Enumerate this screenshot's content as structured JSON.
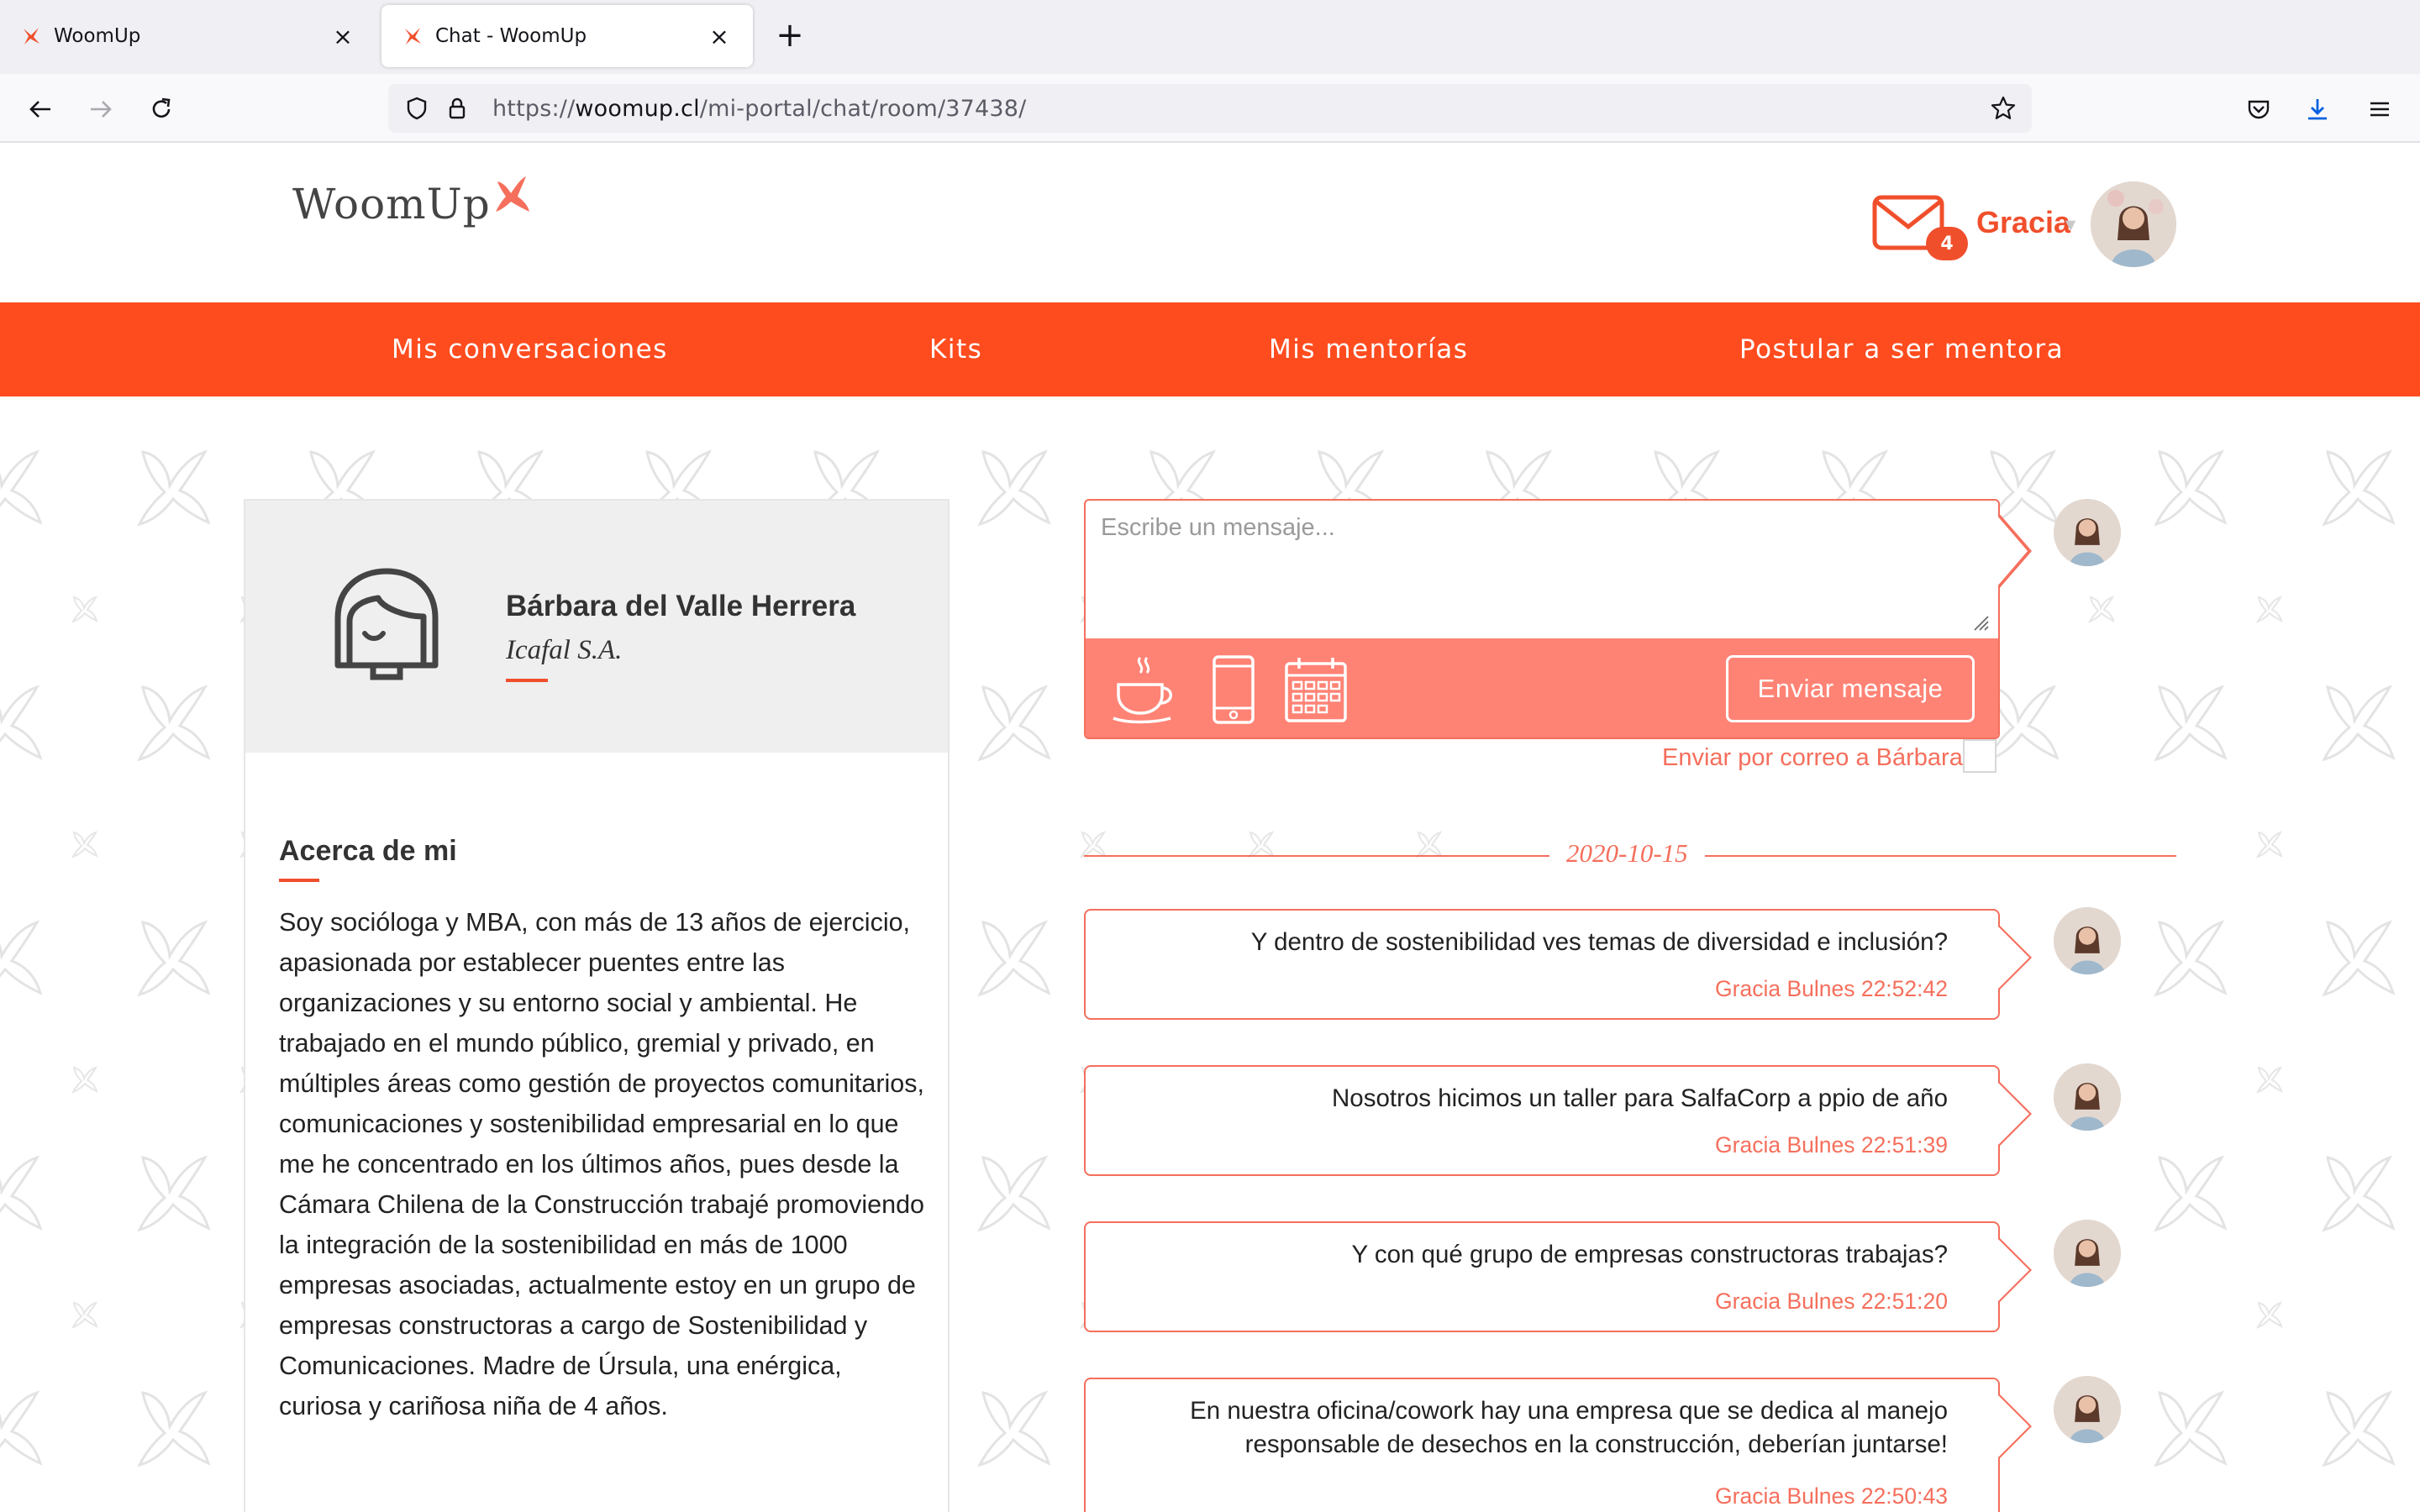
{
  "browser": {
    "tabs": [
      {
        "title": "WoomUp",
        "active": false
      },
      {
        "title": "Chat - WoomUp",
        "active": true
      }
    ],
    "url_prefix": "https://",
    "url_host": "woomup.cl",
    "url_path": "/mi-portal/chat/room/37438/"
  },
  "header": {
    "logo_text": "WoomUp",
    "unread_count": "4",
    "user_name": "Gracia"
  },
  "nav": {
    "items": [
      "Mis conversaciones",
      "Kits",
      "Mis mentorías",
      "Postular a ser mentora"
    ]
  },
  "profile": {
    "name": "Bárbara del Valle Herrera",
    "company": "Icafal S.A.",
    "about_title": "Acerca de mi",
    "about_text": "Soy socióloga y MBA, con más de 13 años de ejercicio, apasionada por establecer puentes entre las organizaciones y su entorno social y ambiental. He trabajado en el mundo público, gremial y privado, en múltiples áreas como gestión de proyectos comunitarios, comunicaciones y sostenibilidad empresarial en lo que me he concentrado en los últimos años, pues desde la Cámara Chilena de la Construcción trabajé promoviendo la integración de la sostenibilidad en más de 1000 empresas asociadas, actualmente estoy en un grupo de empresas constructoras a cargo de Sostenibilidad y Comunicaciones. Madre de Úrsula, una enérgica, curiosa y cariñosa niña de 4 años."
  },
  "composer": {
    "placeholder": "Escribe un mensaje...",
    "send_label": "Enviar mensaje",
    "email_option": "Enviar por correo a Bárbara"
  },
  "chat": {
    "date": "2020-10-15",
    "messages": [
      {
        "text": "Y dentro de sostenibilidad ves temas de diversidad e inclusión?",
        "meta": "Gracia Bulnes 22:52:42"
      },
      {
        "text": "Nosotros hicimos un taller para SalfaCorp a ppio de año",
        "meta": "Gracia Bulnes 22:51:39"
      },
      {
        "text": "Y con qué grupo de empresas constructoras trabajas?",
        "meta": "Gracia Bulnes 22:51:20"
      },
      {
        "text": "En nuestra oficina/cowork hay una empresa que se dedica al manejo responsable de desechos en la construcción, deberían juntarse!",
        "meta": "Gracia Bulnes 22:50:43"
      }
    ]
  },
  "colors": {
    "brand_orange": "#ff4c1f",
    "accent_coral": "#f56f5c",
    "composer_bar": "#ff8375"
  },
  "icons": [
    "woomup-favicon-icon",
    "close-icon",
    "plus-icon",
    "back-icon",
    "forward-icon",
    "reload-icon",
    "shield-icon",
    "lock-icon",
    "star-icon",
    "pocket-icon",
    "download-icon",
    "menu-icon",
    "mail-icon",
    "woman-avatar-icon",
    "coffee-icon",
    "phone-icon",
    "calendar-icon"
  ]
}
